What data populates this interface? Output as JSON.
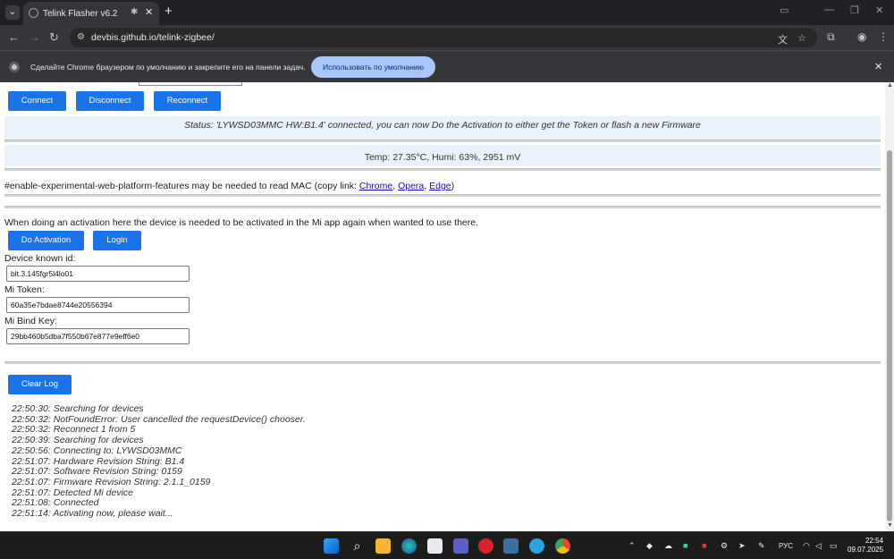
{
  "browser": {
    "tab_title": "Telink Flasher v6.2",
    "url": "devbis.github.io/telink-zigbee/",
    "infobar_text": "Сделайте Chrome браузером по умолчанию и закрепите его на панели задач.",
    "infobar_button": "Использовать по умолчанию"
  },
  "page": {
    "buttons": {
      "connect": "Connect",
      "disconnect": "Disconnect",
      "reconnect": "Reconnect",
      "do_activation": "Do Activation",
      "login": "Login",
      "clear_log": "Clear Log"
    },
    "status": "Status: 'LYWSD03MMC HW:B1.4' connected, you can now Do the Activation to either get the Token or flash a new Firmware",
    "sensor": "Temp: 27.35°C, Humi: 63%, 2951 mV",
    "flag_note_prefix": "#enable-experimental-web-platform-features may be needed to read MAC (copy link: ",
    "flag_links": [
      "Chrome",
      "Opera",
      "Edge"
    ],
    "activation_note": "When doing an activation here the device is needed to be activated in the Mi app again when wanted to use there.",
    "fields": {
      "device_id_label": "Device known id:",
      "device_id_value": "blt.3.145fgr5l4lo01",
      "token_label": "Mi Token:",
      "token_value": "60a35e7bdae8744e20556394",
      "bindkey_label": "Mi Bind Key:",
      "bindkey_value": "29bb460b5dba7f550b67e877e9eff6e0"
    },
    "log": [
      "22:50:30: Searching for devices",
      "22:50:32: NotFoundError: User cancelled the requestDevice() chooser.",
      "22:50:32: Reconnect 1 from 5",
      "22:50:39: Searching for devices",
      "22:50:56: Connecting to: LYWSD03MMC",
      "22:51:07: Hardware Revision String: B1.4",
      "22:51:07: Software Revision String: 0159",
      "22:51:07: Firmware Revision String: 2.1.1_0159",
      "22:51:07: Detected Mi device",
      "22:51:08: Connected",
      "22:51:14: Activating now, please wait..."
    ]
  },
  "taskbar": {
    "lang": "РУС",
    "time": "22:54",
    "date": "09.07.2025"
  }
}
